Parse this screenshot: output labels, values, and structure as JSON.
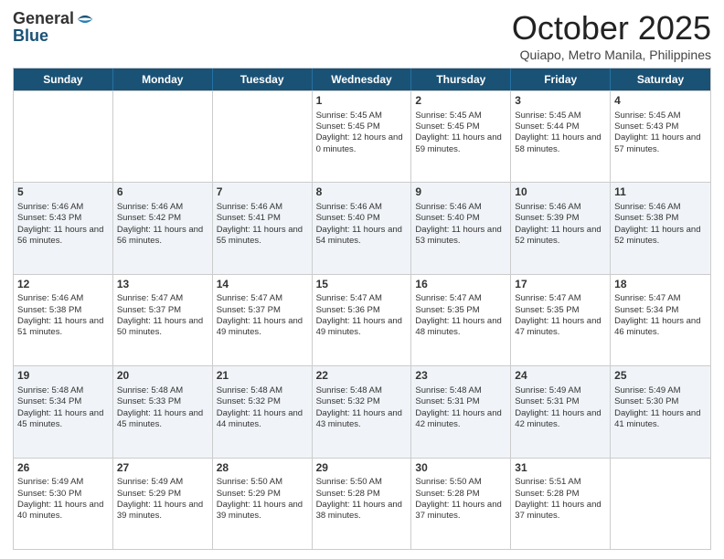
{
  "logo": {
    "general": "General",
    "blue": "Blue"
  },
  "header": {
    "month": "October 2025",
    "location": "Quiapo, Metro Manila, Philippines"
  },
  "days": [
    "Sunday",
    "Monday",
    "Tuesday",
    "Wednesday",
    "Thursday",
    "Friday",
    "Saturday"
  ],
  "rows": [
    [
      {
        "day": "",
        "sunrise": "",
        "sunset": "",
        "daylight": ""
      },
      {
        "day": "",
        "sunrise": "",
        "sunset": "",
        "daylight": ""
      },
      {
        "day": "",
        "sunrise": "",
        "sunset": "",
        "daylight": ""
      },
      {
        "day": "1",
        "sunrise": "Sunrise: 5:45 AM",
        "sunset": "Sunset: 5:45 PM",
        "daylight": "Daylight: 12 hours and 0 minutes."
      },
      {
        "day": "2",
        "sunrise": "Sunrise: 5:45 AM",
        "sunset": "Sunset: 5:45 PM",
        "daylight": "Daylight: 11 hours and 59 minutes."
      },
      {
        "day": "3",
        "sunrise": "Sunrise: 5:45 AM",
        "sunset": "Sunset: 5:44 PM",
        "daylight": "Daylight: 11 hours and 58 minutes."
      },
      {
        "day": "4",
        "sunrise": "Sunrise: 5:45 AM",
        "sunset": "Sunset: 5:43 PM",
        "daylight": "Daylight: 11 hours and 57 minutes."
      }
    ],
    [
      {
        "day": "5",
        "sunrise": "Sunrise: 5:46 AM",
        "sunset": "Sunset: 5:43 PM",
        "daylight": "Daylight: 11 hours and 56 minutes."
      },
      {
        "day": "6",
        "sunrise": "Sunrise: 5:46 AM",
        "sunset": "Sunset: 5:42 PM",
        "daylight": "Daylight: 11 hours and 56 minutes."
      },
      {
        "day": "7",
        "sunrise": "Sunrise: 5:46 AM",
        "sunset": "Sunset: 5:41 PM",
        "daylight": "Daylight: 11 hours and 55 minutes."
      },
      {
        "day": "8",
        "sunrise": "Sunrise: 5:46 AM",
        "sunset": "Sunset: 5:40 PM",
        "daylight": "Daylight: 11 hours and 54 minutes."
      },
      {
        "day": "9",
        "sunrise": "Sunrise: 5:46 AM",
        "sunset": "Sunset: 5:40 PM",
        "daylight": "Daylight: 11 hours and 53 minutes."
      },
      {
        "day": "10",
        "sunrise": "Sunrise: 5:46 AM",
        "sunset": "Sunset: 5:39 PM",
        "daylight": "Daylight: 11 hours and 52 minutes."
      },
      {
        "day": "11",
        "sunrise": "Sunrise: 5:46 AM",
        "sunset": "Sunset: 5:38 PM",
        "daylight": "Daylight: 11 hours and 52 minutes."
      }
    ],
    [
      {
        "day": "12",
        "sunrise": "Sunrise: 5:46 AM",
        "sunset": "Sunset: 5:38 PM",
        "daylight": "Daylight: 11 hours and 51 minutes."
      },
      {
        "day": "13",
        "sunrise": "Sunrise: 5:47 AM",
        "sunset": "Sunset: 5:37 PM",
        "daylight": "Daylight: 11 hours and 50 minutes."
      },
      {
        "day": "14",
        "sunrise": "Sunrise: 5:47 AM",
        "sunset": "Sunset: 5:37 PM",
        "daylight": "Daylight: 11 hours and 49 minutes."
      },
      {
        "day": "15",
        "sunrise": "Sunrise: 5:47 AM",
        "sunset": "Sunset: 5:36 PM",
        "daylight": "Daylight: 11 hours and 49 minutes."
      },
      {
        "day": "16",
        "sunrise": "Sunrise: 5:47 AM",
        "sunset": "Sunset: 5:35 PM",
        "daylight": "Daylight: 11 hours and 48 minutes."
      },
      {
        "day": "17",
        "sunrise": "Sunrise: 5:47 AM",
        "sunset": "Sunset: 5:35 PM",
        "daylight": "Daylight: 11 hours and 47 minutes."
      },
      {
        "day": "18",
        "sunrise": "Sunrise: 5:47 AM",
        "sunset": "Sunset: 5:34 PM",
        "daylight": "Daylight: 11 hours and 46 minutes."
      }
    ],
    [
      {
        "day": "19",
        "sunrise": "Sunrise: 5:48 AM",
        "sunset": "Sunset: 5:34 PM",
        "daylight": "Daylight: 11 hours and 45 minutes."
      },
      {
        "day": "20",
        "sunrise": "Sunrise: 5:48 AM",
        "sunset": "Sunset: 5:33 PM",
        "daylight": "Daylight: 11 hours and 45 minutes."
      },
      {
        "day": "21",
        "sunrise": "Sunrise: 5:48 AM",
        "sunset": "Sunset: 5:32 PM",
        "daylight": "Daylight: 11 hours and 44 minutes."
      },
      {
        "day": "22",
        "sunrise": "Sunrise: 5:48 AM",
        "sunset": "Sunset: 5:32 PM",
        "daylight": "Daylight: 11 hours and 43 minutes."
      },
      {
        "day": "23",
        "sunrise": "Sunrise: 5:48 AM",
        "sunset": "Sunset: 5:31 PM",
        "daylight": "Daylight: 11 hours and 42 minutes."
      },
      {
        "day": "24",
        "sunrise": "Sunrise: 5:49 AM",
        "sunset": "Sunset: 5:31 PM",
        "daylight": "Daylight: 11 hours and 42 minutes."
      },
      {
        "day": "25",
        "sunrise": "Sunrise: 5:49 AM",
        "sunset": "Sunset: 5:30 PM",
        "daylight": "Daylight: 11 hours and 41 minutes."
      }
    ],
    [
      {
        "day": "26",
        "sunrise": "Sunrise: 5:49 AM",
        "sunset": "Sunset: 5:30 PM",
        "daylight": "Daylight: 11 hours and 40 minutes."
      },
      {
        "day": "27",
        "sunrise": "Sunrise: 5:49 AM",
        "sunset": "Sunset: 5:29 PM",
        "daylight": "Daylight: 11 hours and 39 minutes."
      },
      {
        "day": "28",
        "sunrise": "Sunrise: 5:50 AM",
        "sunset": "Sunset: 5:29 PM",
        "daylight": "Daylight: 11 hours and 39 minutes."
      },
      {
        "day": "29",
        "sunrise": "Sunrise: 5:50 AM",
        "sunset": "Sunset: 5:28 PM",
        "daylight": "Daylight: 11 hours and 38 minutes."
      },
      {
        "day": "30",
        "sunrise": "Sunrise: 5:50 AM",
        "sunset": "Sunset: 5:28 PM",
        "daylight": "Daylight: 11 hours and 37 minutes."
      },
      {
        "day": "31",
        "sunrise": "Sunrise: 5:51 AM",
        "sunset": "Sunset: 5:28 PM",
        "daylight": "Daylight: 11 hours and 37 minutes."
      },
      {
        "day": "",
        "sunrise": "",
        "sunset": "",
        "daylight": ""
      }
    ]
  ]
}
